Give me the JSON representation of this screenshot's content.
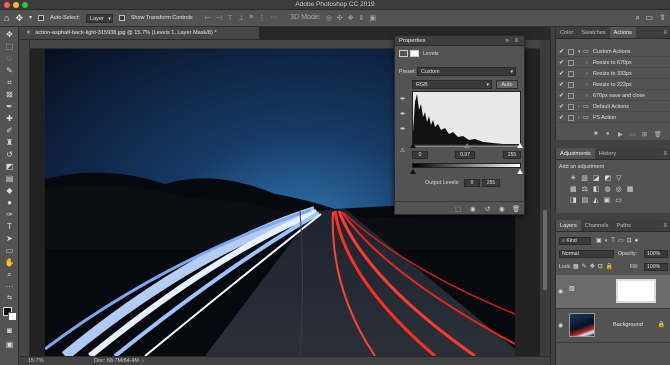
{
  "app": {
    "title": "Adobe Photoshop CC 2019"
  },
  "options_bar": {
    "auto_select_label": "Auto-Select:",
    "auto_select_value": "Layer",
    "show_transform_label": "Show Transform Controls"
  },
  "document": {
    "tab_title": "action-asphalt-back-light-315938.jpg @ 15.7% (Levels 1, Layer Mask/8)",
    "tab_modified": "*",
    "close_icon": "close-icon",
    "zoom": "15.7%",
    "doc_info": "Doc: 68.7M/84.4M"
  },
  "properties": {
    "title": "Properties",
    "subtitle": "Levels",
    "preset_label": "Preset:",
    "preset_value": "Custom",
    "channel": "RGB",
    "auto_label": "Auto",
    "input_black": "0",
    "input_gamma": "0.97",
    "input_white": "255",
    "output_label": "Output Levels:",
    "output_black": "0",
    "output_white": "255"
  },
  "tabs_top": [
    "Color",
    "Swatches",
    "Actions"
  ],
  "actions": [
    {
      "label": "Custom Actions",
      "indent": 0,
      "folder": true,
      "expanded": true
    },
    {
      "label": "Resize to 670px",
      "indent": 1,
      "folder": false
    },
    {
      "label": "Resize to 333px",
      "indent": 1,
      "folder": false
    },
    {
      "label": "Resize to 222px",
      "indent": 1,
      "folder": false
    },
    {
      "label": "670px save and close",
      "indent": 1,
      "folder": false
    },
    {
      "label": "Default Actions",
      "indent": 0,
      "folder": true,
      "expanded": false
    },
    {
      "label": "FS Action",
      "indent": 0,
      "folder": true,
      "expanded": false
    }
  ],
  "tabs_mid": [
    "Adjustments",
    "History"
  ],
  "adjustments": {
    "prompt": "Add an adjustment"
  },
  "tabs_layers": [
    "Layers",
    "Channels",
    "Paths"
  ],
  "layers_panel": {
    "filter_kind": "Kind",
    "blend_mode": "Normal",
    "opacity_label": "Opacity:",
    "opacity_value": "100%",
    "lock_label": "Lock:",
    "fill_label": "Fill:",
    "fill_value": "100%"
  },
  "layers": [
    {
      "name": "",
      "type": "adjustment-levels"
    },
    {
      "name": "Background",
      "type": "image"
    }
  ],
  "colors": {
    "accent": "#d0d0d0",
    "panel_bg": "#535353",
    "canvas_bg": "#282828"
  }
}
